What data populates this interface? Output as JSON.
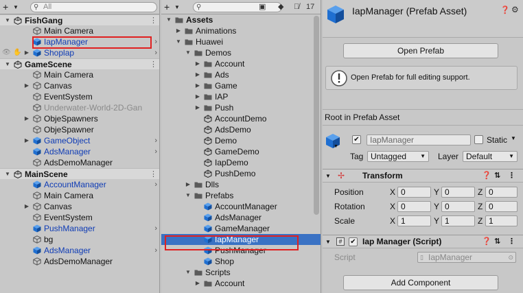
{
  "hierarchy": {
    "search_placeholder": "All",
    "rows": [
      {
        "label": "FishGang",
        "depth": 0,
        "kind": "scene",
        "arrow": "▼",
        "icon": "unity-scene-icon",
        "color": "normal"
      },
      {
        "label": "Main Camera",
        "depth": 1,
        "kind": "go",
        "arrow": "",
        "icon": "gameobject-icon",
        "color": "normal"
      },
      {
        "label": "IapManager",
        "depth": 1,
        "kind": "prefab",
        "arrow": "",
        "icon": "prefab-cube-icon",
        "color": "blue",
        "chevron": true
      },
      {
        "label": "Shoplap",
        "depth": 1,
        "kind": "prefab",
        "arrow": "▶",
        "icon": "prefab-cube-icon",
        "color": "blue",
        "chevron": true
      },
      {
        "label": "GameScene",
        "depth": 0,
        "kind": "scene",
        "arrow": "▼",
        "icon": "unity-scene-icon",
        "color": "normal"
      },
      {
        "label": "Main Camera",
        "depth": 1,
        "kind": "go",
        "arrow": "",
        "icon": "gameobject-icon",
        "color": "normal"
      },
      {
        "label": "Canvas",
        "depth": 1,
        "kind": "go",
        "arrow": "▶",
        "icon": "gameobject-icon",
        "color": "normal"
      },
      {
        "label": "EventSystem",
        "depth": 1,
        "kind": "go",
        "arrow": "",
        "icon": "gameobject-icon",
        "color": "normal"
      },
      {
        "label": "Underwater-World-2D-Gan",
        "depth": 1,
        "kind": "go",
        "arrow": "",
        "icon": "gameobject-icon",
        "color": "gray"
      },
      {
        "label": "ObjeSpawners",
        "depth": 1,
        "kind": "go",
        "arrow": "▶",
        "icon": "gameobject-icon",
        "color": "normal"
      },
      {
        "label": "ObjeSpawner",
        "depth": 1,
        "kind": "go",
        "arrow": "",
        "icon": "gameobject-icon",
        "color": "normal"
      },
      {
        "label": "GameObject",
        "depth": 1,
        "kind": "prefab",
        "arrow": "▶",
        "icon": "prefab-cube-icon",
        "color": "blue",
        "chevron": true
      },
      {
        "label": "AdsManager",
        "depth": 1,
        "kind": "prefab",
        "arrow": "",
        "icon": "prefab-cube-icon",
        "color": "blue",
        "chevron": true
      },
      {
        "label": "AdsDemoManager",
        "depth": 1,
        "kind": "go",
        "arrow": "",
        "icon": "gameobject-icon",
        "color": "normal"
      },
      {
        "label": "MainScene",
        "depth": 0,
        "kind": "scene",
        "arrow": "▼",
        "icon": "unity-scene-icon",
        "color": "normal"
      },
      {
        "label": "AccountManager",
        "depth": 1,
        "kind": "prefab",
        "arrow": "",
        "icon": "prefab-cube-icon",
        "color": "blue",
        "chevron": true
      },
      {
        "label": "Main Camera",
        "depth": 1,
        "kind": "go",
        "arrow": "",
        "icon": "gameobject-icon",
        "color": "normal"
      },
      {
        "label": "Canvas",
        "depth": 1,
        "kind": "go",
        "arrow": "▶",
        "icon": "gameobject-icon",
        "color": "normal"
      },
      {
        "label": "EventSystem",
        "depth": 1,
        "kind": "go",
        "arrow": "",
        "icon": "gameobject-icon",
        "color": "normal"
      },
      {
        "label": "PushManager",
        "depth": 1,
        "kind": "prefab",
        "arrow": "",
        "icon": "prefab-cube-icon",
        "color": "blue",
        "chevron": true
      },
      {
        "label": "bg",
        "depth": 1,
        "kind": "go",
        "arrow": "",
        "icon": "gameobject-icon",
        "color": "normal"
      },
      {
        "label": "AdsManager",
        "depth": 1,
        "kind": "prefab",
        "arrow": "",
        "icon": "prefab-cube-icon",
        "color": "blue",
        "chevron": true
      },
      {
        "label": "AdsDemoManager",
        "depth": 1,
        "kind": "go",
        "arrow": "",
        "icon": "gameobject-icon",
        "color": "normal"
      }
    ]
  },
  "project": {
    "visible_count": "17",
    "rows": [
      {
        "label": "Assets",
        "depth": 0,
        "arrow": "▼",
        "icon": "folder-icon",
        "bold": true
      },
      {
        "label": "Animations",
        "depth": 1,
        "arrow": "▶",
        "icon": "folder-icon"
      },
      {
        "label": "Huawei",
        "depth": 1,
        "arrow": "▼",
        "icon": "folder-icon"
      },
      {
        "label": "Demos",
        "depth": 2,
        "arrow": "▼",
        "icon": "folder-icon"
      },
      {
        "label": "Account",
        "depth": 3,
        "arrow": "▶",
        "icon": "folder-icon"
      },
      {
        "label": "Ads",
        "depth": 3,
        "arrow": "▶",
        "icon": "folder-icon"
      },
      {
        "label": "Game",
        "depth": 3,
        "arrow": "▶",
        "icon": "folder-icon"
      },
      {
        "label": "IAP",
        "depth": 3,
        "arrow": "▶",
        "icon": "folder-icon"
      },
      {
        "label": "Push",
        "depth": 3,
        "arrow": "▶",
        "icon": "folder-icon"
      },
      {
        "label": "AccountDemo",
        "depth": 3,
        "arrow": "",
        "icon": "unity-scene-icon"
      },
      {
        "label": "AdsDemo",
        "depth": 3,
        "arrow": "",
        "icon": "unity-scene-icon"
      },
      {
        "label": "Demo",
        "depth": 3,
        "arrow": "",
        "icon": "unity-scene-icon"
      },
      {
        "label": "GameDemo",
        "depth": 3,
        "arrow": "",
        "icon": "unity-scene-icon"
      },
      {
        "label": "IapDemo",
        "depth": 3,
        "arrow": "",
        "icon": "unity-scene-icon"
      },
      {
        "label": "PushDemo",
        "depth": 3,
        "arrow": "",
        "icon": "unity-scene-icon"
      },
      {
        "label": "Dlls",
        "depth": 2,
        "arrow": "▶",
        "icon": "folder-icon"
      },
      {
        "label": "Prefabs",
        "depth": 2,
        "arrow": "▼",
        "icon": "folder-icon"
      },
      {
        "label": "AccountManager",
        "depth": 3,
        "arrow": "",
        "icon": "prefab-cube-icon"
      },
      {
        "label": "AdsManager",
        "depth": 3,
        "arrow": "",
        "icon": "prefab-cube-icon"
      },
      {
        "label": "GameManager",
        "depth": 3,
        "arrow": "",
        "icon": "prefab-cube-icon"
      },
      {
        "label": "IapManager",
        "depth": 3,
        "arrow": "",
        "icon": "prefab-cube-icon",
        "selected": true
      },
      {
        "label": "PushManager",
        "depth": 3,
        "arrow": "",
        "icon": "prefab-cube-icon"
      },
      {
        "label": "Shop",
        "depth": 3,
        "arrow": "",
        "icon": "prefab-cube-icon"
      },
      {
        "label": "Scripts",
        "depth": 2,
        "arrow": "▼",
        "icon": "folder-icon"
      },
      {
        "label": "Account",
        "depth": 3,
        "arrow": "▶",
        "icon": "folder-icon"
      }
    ]
  },
  "inspector": {
    "title": "IapManager (Prefab Asset)",
    "open_prefab_label": "Open Prefab",
    "help_text": "Open Prefab for full editing support.",
    "root_label": "Root in Prefab Asset",
    "object_name": "IapManager",
    "static_label": "Static",
    "tag_label": "Tag",
    "tag_value": "Untagged",
    "layer_label": "Layer",
    "layer_value": "Default",
    "transform": {
      "title": "Transform",
      "rows": [
        {
          "label": "Position",
          "x": "0",
          "y": "0",
          "z": "0"
        },
        {
          "label": "Rotation",
          "x": "0",
          "y": "0",
          "z": "0"
        },
        {
          "label": "Scale",
          "x": "1",
          "y": "1",
          "z": "1"
        }
      ],
      "axis_x": "X",
      "axis_y": "Y",
      "axis_z": "Z"
    },
    "script_component": {
      "title": "Iap Manager (Script)",
      "script_label": "Script",
      "script_value": "IapManager"
    },
    "add_component_label": "Add Component"
  },
  "colors": {
    "prefab_blue": "#1f6fd1",
    "selection_blue": "#3a72c4",
    "highlight_red": "#e02020"
  }
}
